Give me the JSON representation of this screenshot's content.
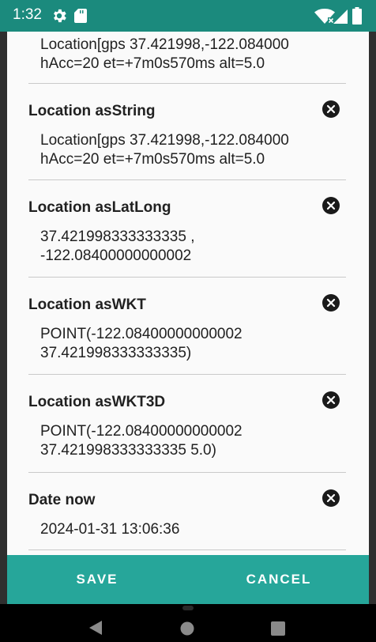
{
  "status_bar": {
    "time": "1:32",
    "icons": [
      "gear-icon",
      "sd-card-icon",
      "wifi-icon",
      "signal-icon",
      "battery-icon"
    ],
    "color": "#1b8a7d"
  },
  "items": [
    {
      "title": "",
      "value": "Location[gps 37.421998,-122.084000\nhAcc=20 et=+7m0s570ms alt=5.0"
    },
    {
      "title": "Location asString",
      "value": "Location[gps 37.421998,-122.084000\nhAcc=20 et=+7m0s570ms alt=5.0"
    },
    {
      "title": "Location asLatLong",
      "value": "37.421998333333335 ,\n-122.08400000000002"
    },
    {
      "title": "Location asWKT",
      "value": "POINT(-122.08400000000002\n37.421998333333335)"
    },
    {
      "title": "Location asWKT3D",
      "value": "POINT(-122.08400000000002\n37.421998333333335 5.0)"
    },
    {
      "title": "Date now",
      "value": "2024-01-31 13:06:36"
    }
  ],
  "buttons": {
    "save": "SAVE",
    "cancel": "CANCEL",
    "color": "#26a69a"
  },
  "nav_bar": {
    "icons": [
      "back-icon",
      "home-icon",
      "recents-icon"
    ]
  }
}
